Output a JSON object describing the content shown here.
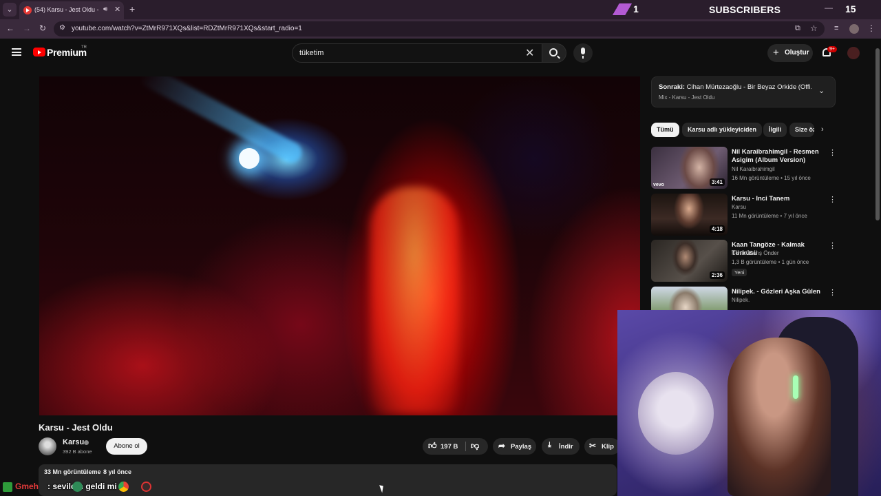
{
  "browser": {
    "tab_title": "(54) Karsu - Jest Oldu - YouTube",
    "url": "youtube.com/watch?v=ZtMrR971XQs&list=RDZtMrR971XQs&start_radio=1"
  },
  "stream_overlay": {
    "sub_count": "1",
    "label": "SUBSCRIBERS",
    "goal": "15"
  },
  "header": {
    "brand": "Premium",
    "region": "TR",
    "search_value": "tüketim",
    "create_label": "Oluştur",
    "notification_count": "9+"
  },
  "video": {
    "title": "Karsu - Jest Oldu",
    "channel": "Karsu",
    "subscribers": "392 B abone",
    "subscribe_label": "Abone ol",
    "likes": "197 B",
    "share_label": "Paylaş",
    "download_label": "İndir",
    "clip_label": "Klip",
    "views": "33 Mn görüntüleme",
    "date": "8 yıl önce"
  },
  "up_next": {
    "prefix": "Sonraki:",
    "title": "Cihan Mürtezaoğlu - Bir Beyaz Orkide (Offi...",
    "subtitle": "Mix - Karsu - Jest Oldu"
  },
  "chips": [
    "Tümü",
    "Karsu adlı yükleyiciden",
    "İlgili",
    "Size öz"
  ],
  "recommendations": [
    {
      "title": "Nil Karaibrahimgil - Resmen Asigim (Album Version)",
      "channel": "Nil Karaibrahimgil",
      "meta": "16 Mn görüntüleme • 15 yıl önce",
      "duration": "3:41",
      "badge": "",
      "vevo": "vevo"
    },
    {
      "title": "Karsu - Inci Tanem",
      "channel": "Karsu",
      "meta": "11 Mn görüntüleme • 7 yıl önce",
      "duration": "4:18",
      "badge": "",
      "vevo": ""
    },
    {
      "title": "Kaan Tangöze - Kalmak Türküsü",
      "channel": "Kenan Barış Önder",
      "meta": "1,3 B görüntüleme • 1 gün önce",
      "duration": "2:36",
      "badge": "Yeni",
      "vevo": ""
    },
    {
      "title": "Nilipek. - Gözleri Aşka Gülen",
      "channel": "Nilipek.",
      "meta": "",
      "duration": "",
      "badge": "",
      "vevo": ""
    }
  ],
  "chat": {
    "user": "Gmeh",
    "message": ": sevildin geldi mi"
  }
}
